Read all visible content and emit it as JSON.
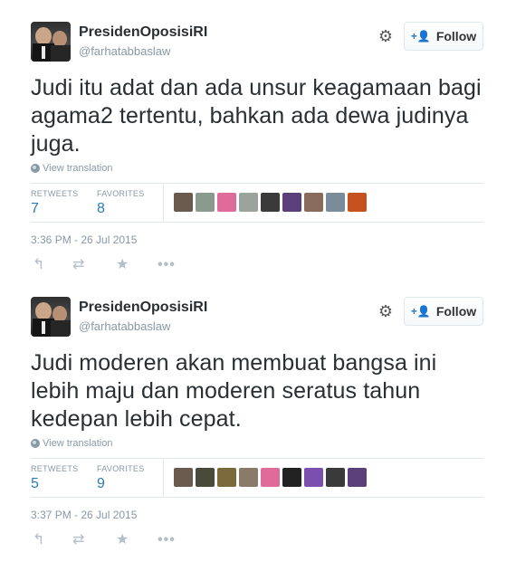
{
  "tweets": [
    {
      "display_name": "PresidenOposisiRI",
      "handle": "@farhatabbaslaw",
      "follow_label": "Follow",
      "text": "Judi itu adat dan ada unsur keagamaan bagi agama2 tertentu, bahkan ada dewa judinya juga.",
      "translate_label": "View translation",
      "retweets_label": "RETWEETS",
      "retweets_count": "7",
      "favorites_label": "FAVORITES",
      "favorites_count": "8",
      "favoriter_avatar_colors": [
        "#6b5a4e",
        "#8a9a8c",
        "#e06a9a",
        "#9aa39c",
        "#3a3a3a",
        "#5b3f7a",
        "#8a6a5a",
        "#7a8c9a",
        "#c5521f"
      ],
      "timestamp": "3:36 PM - 26 Jul 2015"
    },
    {
      "display_name": "PresidenOposisiRI",
      "handle": "@farhatabbaslaw",
      "follow_label": "Follow",
      "text": "Judi moderen akan membuat bangsa ini lebih maju dan moderen seratus tahun kedepan lebih cepat.",
      "translate_label": "View translation",
      "retweets_label": "RETWEETS",
      "retweets_count": "5",
      "favorites_label": "FAVORITES",
      "favorites_count": "9",
      "favoriter_avatar_colors": [
        "#6b5a4e",
        "#4a4a3a",
        "#7a6a3a",
        "#8a7a6a",
        "#e06a9a",
        "#222222",
        "#7b4fb0",
        "#3a3a3a",
        "#5b3f7a"
      ],
      "timestamp": "3:37 PM - 26 Jul 2015"
    }
  ],
  "icons": {
    "settings": "gear-icon",
    "follow": "follow-person-icon",
    "globe": "globe-icon",
    "reply": "reply-icon",
    "retweet": "retweet-icon",
    "favorite": "star-icon",
    "more": "more-icon"
  },
  "colors": {
    "link_blue": "#2b7bb9",
    "muted": "#8899a6",
    "border": "#e1e8ed"
  }
}
